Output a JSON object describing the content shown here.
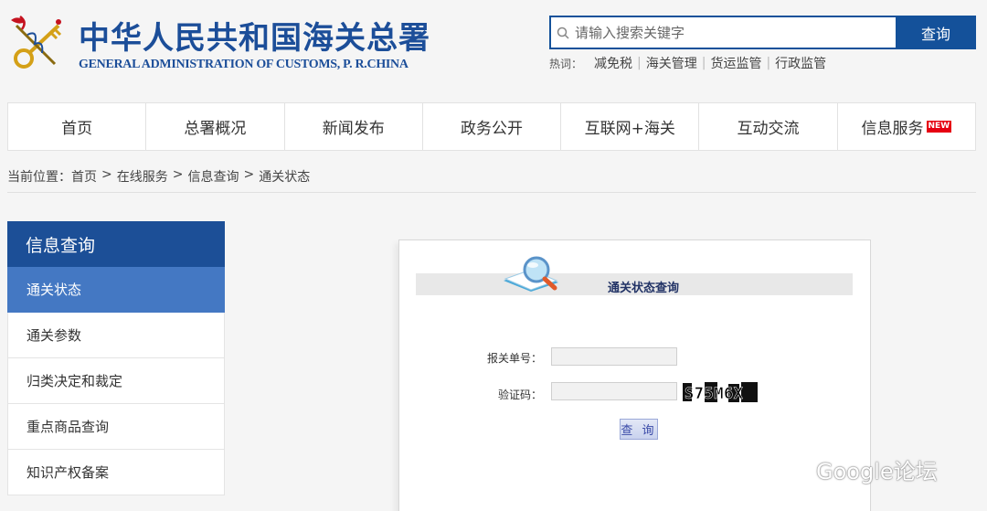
{
  "header": {
    "title_cn": "中华人民共和国海关总署",
    "title_en": "GENERAL ADMINISTRATION OF CUSTOMS, P. R.CHINA",
    "search": {
      "placeholder": "请输入搜索关键字",
      "button": "查询"
    },
    "hot_label": "热词：",
    "hot_words": [
      "减免税",
      "海关管理",
      "货运监管",
      "行政监管"
    ],
    "hot_sep": "|"
  },
  "nav": [
    {
      "label": "首页"
    },
    {
      "label": "总署概况"
    },
    {
      "label": "新闻发布"
    },
    {
      "label": "政务公开"
    },
    {
      "label": "互联网+海关"
    },
    {
      "label": "互动交流"
    },
    {
      "label": "信息服务",
      "badge": "NEW"
    }
  ],
  "breadcrumb": {
    "prefix": "当前位置：",
    "items": [
      "首页",
      "在线服务",
      "信息查询",
      "通关状态"
    ],
    "sep": ">"
  },
  "sidebar": {
    "title": "信息查询",
    "items": [
      "通关状态",
      "通关参数",
      "归类决定和裁定",
      "重点商品查询",
      "知识产权备案"
    ],
    "active_index": 0
  },
  "panel": {
    "title": "通关状态查询",
    "fields": [
      {
        "label": "报关单号：",
        "value": ""
      },
      {
        "label": "验证码：",
        "value": ""
      }
    ],
    "captcha_text": "S75M6X",
    "button": "查 询"
  },
  "watermark": {
    "text": "Google论坛"
  },
  "colors": {
    "brand": "#1c4e99",
    "nav_active": "#4478c3",
    "badge": "#e60012"
  }
}
